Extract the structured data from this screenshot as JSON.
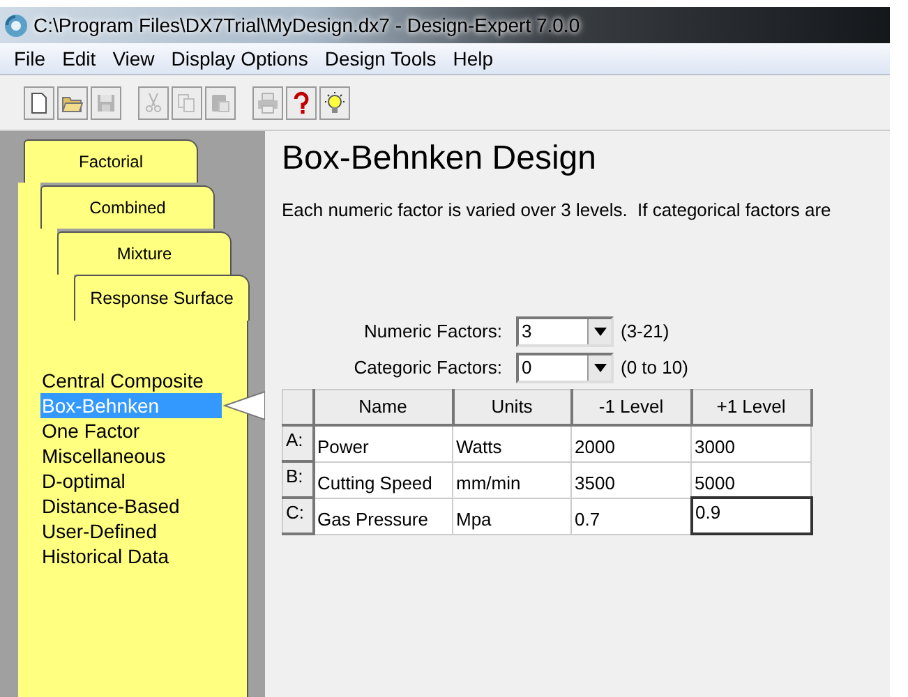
{
  "window": {
    "title": "C:\\Program Files\\DX7Trial\\MyDesign.dx7 - Design-Expert 7.0.0"
  },
  "menu": [
    "File",
    "Edit",
    "View",
    "Display Options",
    "Design Tools",
    "Help"
  ],
  "toolbar": [
    {
      "kind": "new",
      "disabled": false
    },
    {
      "kind": "open",
      "disabled": false
    },
    {
      "kind": "save",
      "disabled": true
    },
    {
      "kind": "separator"
    },
    {
      "kind": "cut",
      "disabled": true
    },
    {
      "kind": "copy",
      "disabled": true
    },
    {
      "kind": "paste",
      "disabled": true
    },
    {
      "kind": "separator"
    },
    {
      "kind": "print",
      "disabled": true
    },
    {
      "kind": "help",
      "disabled": false
    },
    {
      "kind": "tip",
      "disabled": false
    }
  ],
  "tabs": [
    {
      "label": "Factorial",
      "selected": false
    },
    {
      "label": "Combined",
      "selected": false
    },
    {
      "label": "Mixture",
      "selected": false
    },
    {
      "label": "Response Surface",
      "selected": true
    }
  ],
  "designs": [
    {
      "label": "Central Composite",
      "selected": false
    },
    {
      "label": "Box-Behnken",
      "selected": true
    },
    {
      "label": "One Factor",
      "selected": false
    },
    {
      "label": "Miscellaneous",
      "selected": false
    },
    {
      "label": "D-optimal",
      "selected": false
    },
    {
      "label": "Distance-Based",
      "selected": false
    },
    {
      "label": "User-Defined",
      "selected": false
    },
    {
      "label": "Historical Data",
      "selected": false
    }
  ],
  "content": {
    "title": "Box-Behnken Design",
    "description": "Each numeric factor is varied over 3 levels.  If categorical factors are",
    "fields": [
      {
        "label": "Numeric Factors:",
        "value": "3",
        "range": "(3-21)"
      },
      {
        "label": "Categoric Factors:",
        "value": "0",
        "range": "(0 to 10)"
      }
    ],
    "table": {
      "columns": [
        "Name",
        "Units",
        "-1 Level",
        "+1 Level"
      ],
      "rows": [
        {
          "label": "A:",
          "cells": [
            "Power",
            "Watts",
            "2000",
            "3000"
          ],
          "editing_last": false
        },
        {
          "label": "B:",
          "cells": [
            "Cutting Speed",
            "mm/min",
            "3500",
            "5000"
          ],
          "editing_last": false
        },
        {
          "label": "C:",
          "cells": [
            "Gas Pressure",
            "Mpa",
            "0.7",
            "0.9"
          ],
          "editing_last": true
        }
      ]
    }
  }
}
